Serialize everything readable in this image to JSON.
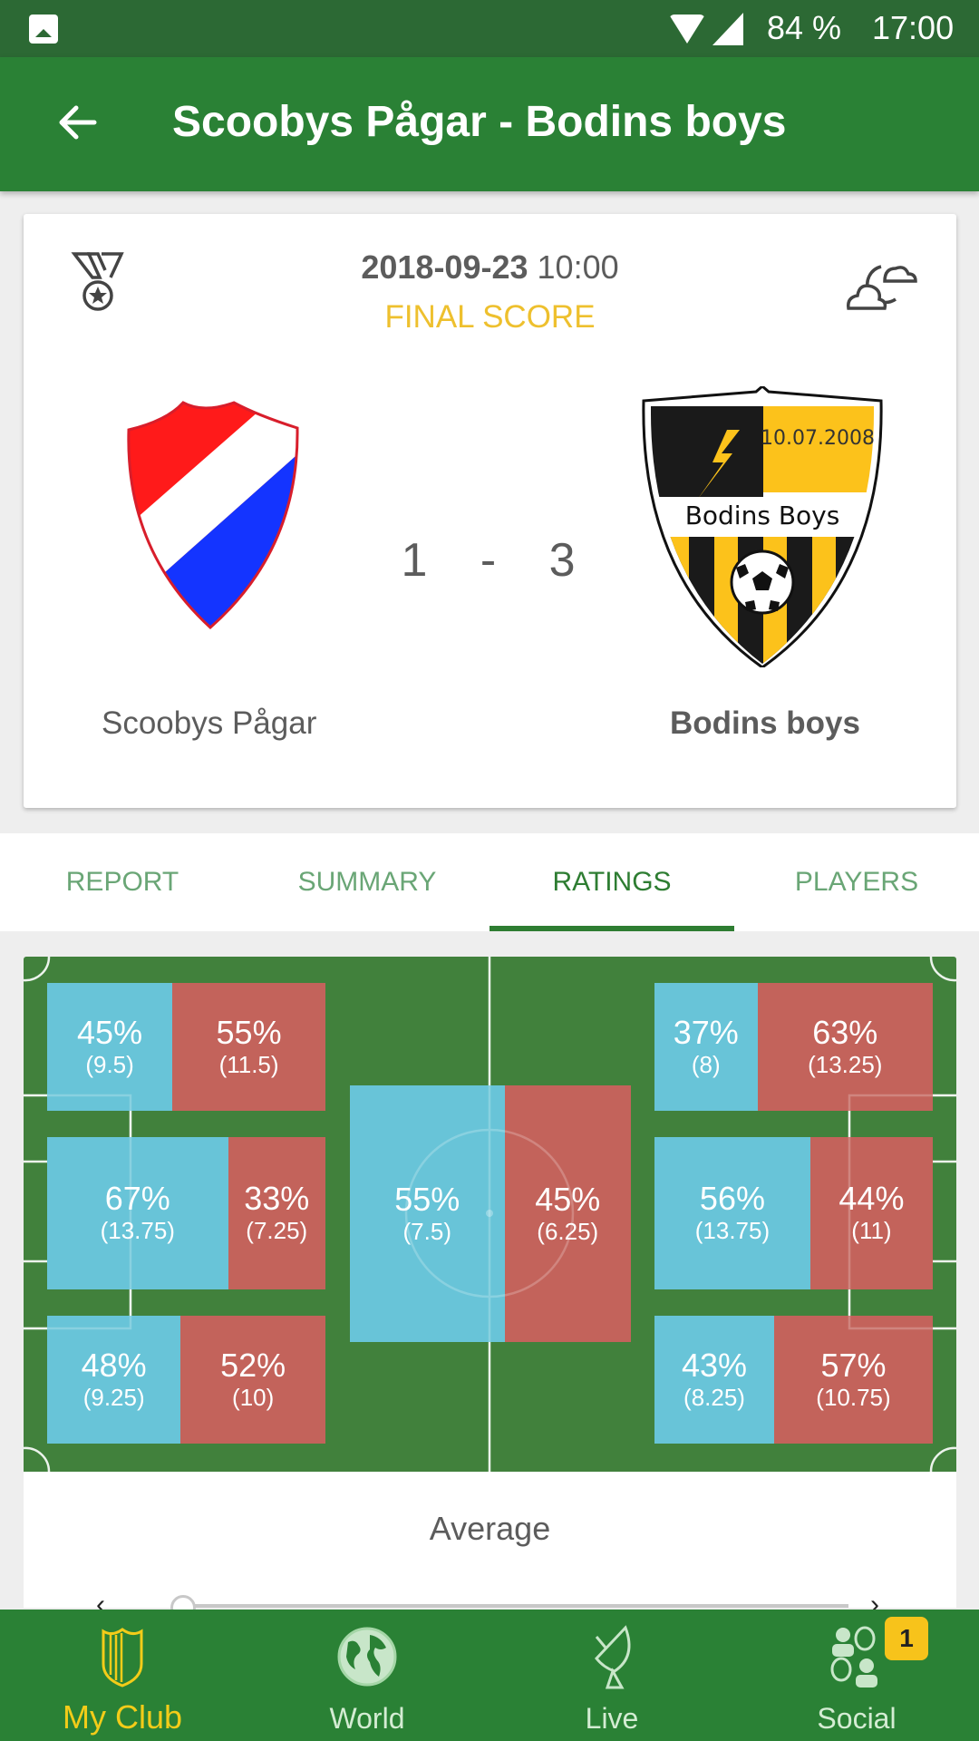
{
  "status_bar": {
    "battery": "84 %",
    "time": "17:00",
    "icons": [
      "image-icon",
      "wifi-icon",
      "signal-icon"
    ]
  },
  "app_bar": {
    "back_icon": "arrow-left-icon",
    "title": "Scoobys Pågar - Bodins boys"
  },
  "match": {
    "date": "2018-09-23",
    "time": "10:00",
    "status": "FINAL SCORE",
    "home_score": "1",
    "separator": "-",
    "away_score": "3",
    "home_team": "Scoobys Pågar",
    "away_team": "Bodins boys",
    "away_crest_date": "10.07.2008",
    "away_crest_name": "Bodins Boys",
    "left_icon": "medal-icon",
    "right_icon": "weather-cloudy-night-icon"
  },
  "tabs": [
    {
      "label": "REPORT",
      "active": false
    },
    {
      "label": "SUMMARY",
      "active": false
    },
    {
      "label": "RATINGS",
      "active": true
    },
    {
      "label": "PLAYERS",
      "active": false
    }
  ],
  "colors": {
    "home": "#68c4d8",
    "away": "#c3635b",
    "pitch": "#41813c",
    "accent": "#2e7d32",
    "highlight": "#f3cc19"
  },
  "ratings": {
    "zones": [
      {
        "id": "left-top",
        "home_pct": "45%",
        "home_pts": "(9.5)",
        "away_pct": "55%",
        "away_pts": "(11.5)",
        "home_share": 0.45
      },
      {
        "id": "left-mid",
        "home_pct": "67%",
        "home_pts": "(13.75)",
        "away_pct": "33%",
        "away_pts": "(7.25)",
        "home_share": 0.67
      },
      {
        "id": "left-bottom",
        "home_pct": "48%",
        "home_pts": "(9.25)",
        "away_pct": "52%",
        "away_pts": "(10)",
        "home_share": 0.48
      },
      {
        "id": "center",
        "home_pct": "55%",
        "home_pts": "(7.5)",
        "away_pct": "45%",
        "away_pts": "(6.25)",
        "home_share": 0.55
      },
      {
        "id": "right-top",
        "home_pct": "37%",
        "home_pts": "(8)",
        "away_pct": "63%",
        "away_pts": "(13.25)",
        "home_share": 0.37
      },
      {
        "id": "right-mid",
        "home_pct": "56%",
        "home_pts": "(13.75)",
        "away_pct": "44%",
        "away_pts": "(11)",
        "home_share": 0.56
      },
      {
        "id": "right-bottom",
        "home_pct": "43%",
        "home_pts": "(8.25)",
        "away_pct": "57%",
        "away_pts": "(10.75)",
        "home_share": 0.43
      }
    ],
    "view_label": "Average",
    "slider_position": 0
  },
  "bottom_nav": [
    {
      "label": "My Club",
      "icon": "shield-icon",
      "active": true
    },
    {
      "label": "World",
      "icon": "globe-icon",
      "active": false
    },
    {
      "label": "Live",
      "icon": "satellite-dish-icon",
      "active": false
    },
    {
      "label": "Social",
      "icon": "people-chat-icon",
      "active": false,
      "badge": "1"
    }
  ]
}
